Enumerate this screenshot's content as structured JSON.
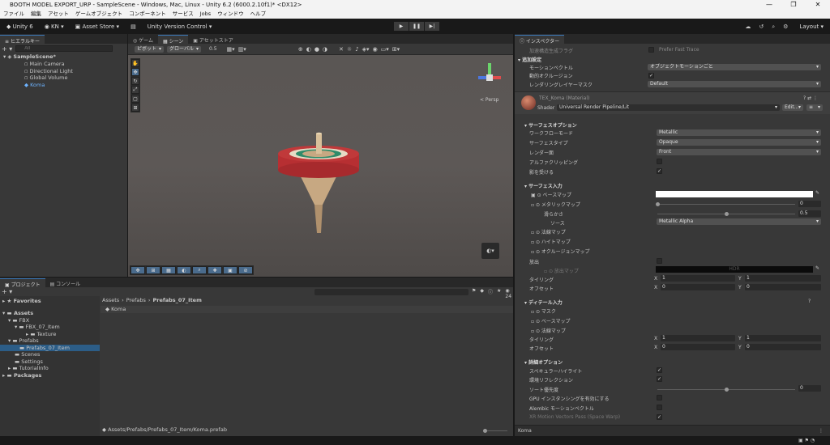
{
  "window": {
    "title": "BOOTH MODEL EXPORT_URP - SampleScene - Windows, Mac, Linux - Unity 6.2 (6000.2.10f1)* <DX12>",
    "controls": [
      "—",
      "❐",
      "✕"
    ]
  },
  "menu": [
    "ファイル",
    "編集",
    "アセット",
    "ゲームオブジェクト",
    "コンポーネント",
    "サービス",
    "Jobs",
    "ウィンドウ",
    "ヘルプ"
  ],
  "toolbar": {
    "unity": "Unity 6",
    "account": "KN",
    "asset_store": "Asset Store",
    "version_control": "Unity Version Control",
    "layout": "Layout"
  },
  "hierarchy": {
    "tab": "ヒエラルキー",
    "search_placeholder": "All",
    "scene": "SampleScene*",
    "items": [
      "Main Camera",
      "Directional Light",
      "Global Volume",
      "Koma"
    ]
  },
  "scene_view": {
    "tabs": [
      "ゲーム",
      "シーン",
      "アセットストア"
    ],
    "pivot": "ピボット",
    "global": "グローバル",
    "snap": "0.5",
    "persp": "< Persp"
  },
  "project": {
    "tabs": [
      "プロジェクト",
      "コンソール"
    ],
    "count": "24",
    "favorites": "Favorites",
    "assets": "Assets",
    "tree": [
      "FBX",
      "FBX_07_Item",
      "Texture",
      "Prefabs",
      "Prefabs_07_Item",
      "Scenes",
      "Settings",
      "TutorialInfo",
      "Packages"
    ],
    "breadcrumb": [
      "Assets",
      "Prefabs",
      "Prefabs_07_Item"
    ],
    "files": [
      "Koma"
    ],
    "path": "Assets/Prefabs/Prefabs_07_Item/Koma.prefab"
  },
  "inspector": {
    "tab": "インスペクター",
    "prefer_fast_trace": "加速構造生成フラグ",
    "prefer_fast_trace_value": "Prefer Fast Trace",
    "additional": "追加設定",
    "motion_vectors": "モーションベクトル",
    "motion_vectors_value": "オブジェクトモーションごと",
    "dynamic_occlusion": "動的オクルージョン",
    "rendering_layer": "レンダリングレイヤーマスク",
    "rendering_layer_value": "Default",
    "material": "TEX_Koma (Material)",
    "shader_label": "Shader",
    "shader": "Universal Render Pipeline/Lit",
    "edit": "Edit...",
    "surface_options": "サーフェスオプション",
    "workflow": "ワークフローモード",
    "workflow_value": "Metallic",
    "surface_type": "サーフェスタイプ",
    "surface_type_value": "Opaque",
    "render_face": "レンダー面",
    "render_face_value": "Front",
    "alpha_clip": "アルファクリッピング",
    "receive_shadows": "影を受ける",
    "surface_inputs": "サーフェス入力",
    "base_map": "ベースマップ",
    "metallic_map": "メタリックマップ",
    "metallic_value": "0",
    "smoothness": "滑らかさ",
    "smoothness_value": "0.5",
    "source": "ソース",
    "source_value": "Metallic Alpha",
    "normal_map": "法線マップ",
    "height_map": "ハイトマップ",
    "occlusion_map": "オクルージョンマップ",
    "emission": "放出",
    "emission_map": "放出マップ",
    "hdr": "HDR",
    "tiling": "タイリング",
    "offset": "オフセット",
    "tiling_x": "1",
    "tiling_y": "1",
    "offset_x": "0",
    "offset_y": "0",
    "detail_inputs": "ディテール入力",
    "mask": "マスク",
    "detail_base": "ベースマップ",
    "detail_normal": "法線マップ",
    "d_tiling_x": "1",
    "d_tiling_y": "1",
    "d_offset_x": "0",
    "d_offset_y": "0",
    "advanced": "詳細オプション",
    "specular": "スペキュラーハイライト",
    "reflections": "環境リフレクション",
    "sort_priority": "ソート優先度",
    "sort_value": "0",
    "gpu_instancing": "GPU インスタンシングを有効にする",
    "alembic": "Alembic モーションベクトル",
    "xr_motion": "XR Motion Vectors Pass (Space Warp)",
    "footer": "Koma"
  }
}
